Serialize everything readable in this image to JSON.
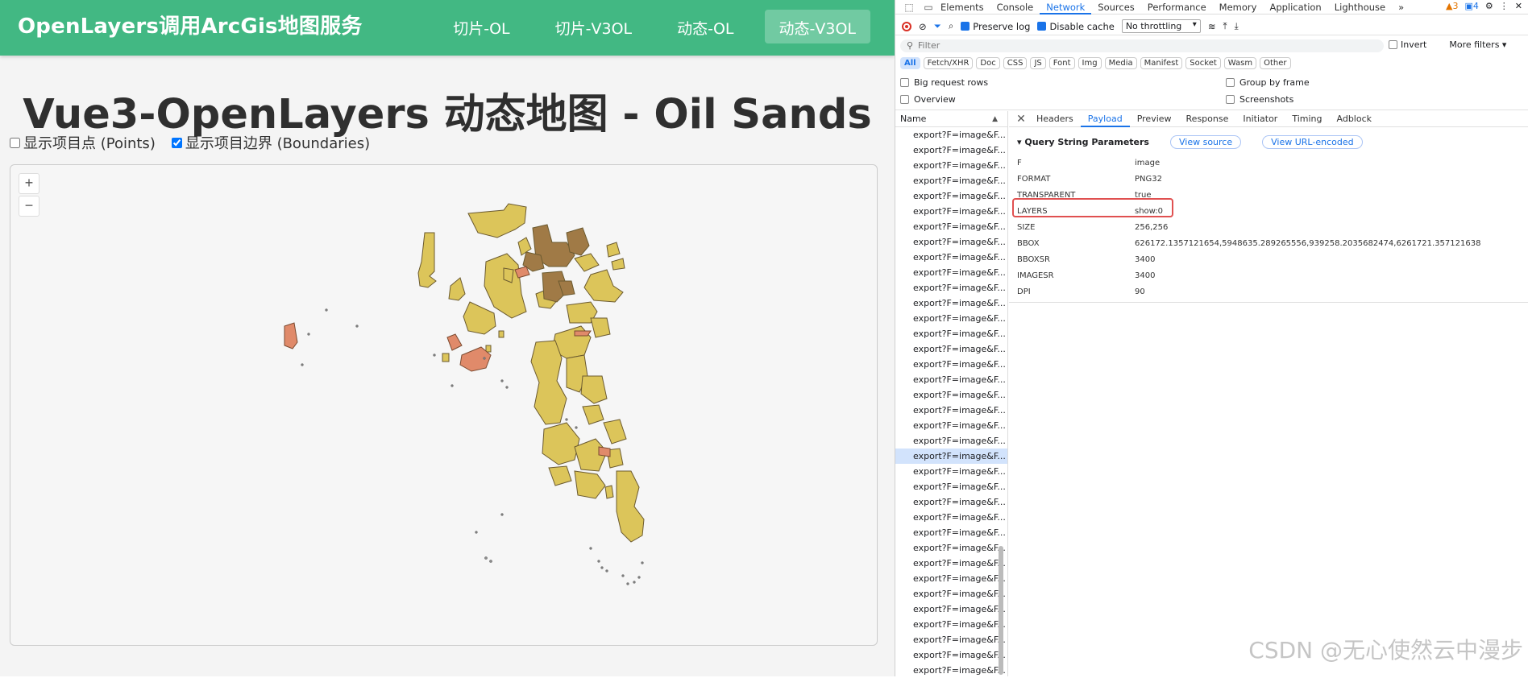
{
  "app": {
    "brand": "OpenLayers调用ArcGis地图服务",
    "nav": [
      "切片-OL",
      "切片-V3OL",
      "动态-OL",
      "动态-V3OL"
    ],
    "active_nav": 3,
    "title": "Vue3-OpenLayers 动态地图 - Oil Sands",
    "controls": {
      "points_label": "显示项目点 (Points)",
      "points_checked": false,
      "boundaries_label": "显示项目边界 (Boundaries)",
      "boundaries_checked": true
    },
    "zoom_in": "+",
    "zoom_out": "−",
    "colors": {
      "header": "#42b883",
      "polygon_yellow": "#dcc55a",
      "polygon_brown": "#9c7a4a",
      "polygon_red": "#e08060"
    }
  },
  "devtools": {
    "tabs": [
      "Elements",
      "Console",
      "Network",
      "Sources",
      "Performance",
      "Memory",
      "Application",
      "Lighthouse",
      "»"
    ],
    "active_tab": "Network",
    "warnings": "3",
    "infos": "4",
    "toolbar": {
      "preserve_log": "Preserve log",
      "disable_cache": "Disable cache",
      "throttling": "No throttling"
    },
    "filter_placeholder": "Filter",
    "invert": "Invert",
    "more_filters": "More filters ▾",
    "types": [
      "All",
      "Fetch/XHR",
      "Doc",
      "CSS",
      "JS",
      "Font",
      "Img",
      "Media",
      "Manifest",
      "Socket",
      "Wasm",
      "Other"
    ],
    "options": {
      "big_rows": "Big request rows",
      "group_frame": "Group by frame",
      "overview": "Overview",
      "screenshots": "Screenshots"
    },
    "list_header": "Name",
    "requests": [
      "export?F=image&F...",
      "export?F=image&F...",
      "export?F=image&F...",
      "export?F=image&F...",
      "export?F=image&F...",
      "export?F=image&F...",
      "export?F=image&F...",
      "export?F=image&F...",
      "export?F=image&F...",
      "export?F=image&F...",
      "export?F=image&F...",
      "export?F=image&F...",
      "export?F=image&F...",
      "export?F=image&F...",
      "export?F=image&F...",
      "export?F=image&F...",
      "export?F=image&F...",
      "export?F=image&F...",
      "export?F=image&F...",
      "export?F=image&F...",
      "export?F=image&F...",
      "export?F=image&F...",
      "export?F=image&F...",
      "export?F=image&F...",
      "export?F=image&F...",
      "export?F=image&F...",
      "export?F=image&F...",
      "export?F=image&F...",
      "export?F=image&F...",
      "export?F=image&F...",
      "export?F=image&F...",
      "export?F=image&F...",
      "export?F=image&F...",
      "export?F=image&F...",
      "export?F=image&F...",
      "export?F=image&F..."
    ],
    "selected_request": 21,
    "detail_tabs": [
      "Headers",
      "Payload",
      "Preview",
      "Response",
      "Initiator",
      "Timing",
      "Adblock"
    ],
    "active_detail_tab": "Payload",
    "qsp_title": "▾ Query String Parameters",
    "view_source": "View source",
    "view_url_encoded": "View URL-encoded",
    "params": [
      {
        "k": "F",
        "v": "image"
      },
      {
        "k": "FORMAT",
        "v": "PNG32"
      },
      {
        "k": "TRANSPARENT",
        "v": "true"
      },
      {
        "k": "LAYERS",
        "v": "show:0"
      },
      {
        "k": "SIZE",
        "v": "256,256"
      },
      {
        "k": "BBOX",
        "v": "626172.1357121654,5948635.289265556,939258.2035682474,6261721.357121638"
      },
      {
        "k": "BBOXSR",
        "v": "3400"
      },
      {
        "k": "IMAGESR",
        "v": "3400"
      },
      {
        "k": "DPI",
        "v": "90"
      }
    ]
  },
  "watermark": "CSDN @无心使然云中漫步"
}
